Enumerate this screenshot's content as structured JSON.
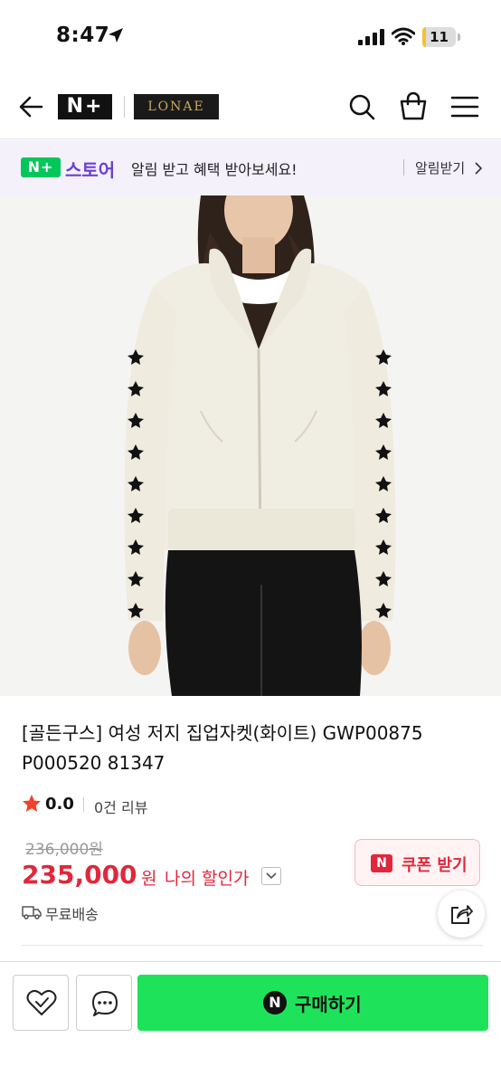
{
  "status_bar": {
    "time": "8:47",
    "battery": "11",
    "battery_level": 0.11
  },
  "header": {
    "platform_logo": "N+",
    "brand_logo": "LONAE"
  },
  "promo": {
    "badge": "N+",
    "store": "스토어",
    "message": "알림 받고 혜택 받아보세요!",
    "action": "알림받기"
  },
  "product": {
    "title": "[골든구스] 여성 저지 집업자켓(화이트) GWP00875 P000520 81347",
    "rating": "0.0",
    "reviews": "0건 리뷰",
    "original_price": "236,000원",
    "sale_price": "235,000",
    "sale_unit": "원",
    "my_price_label": "나의 할인가",
    "shipping": "무료배송"
  },
  "coupon": {
    "icon": "N",
    "label": "쿠폰 받기"
  },
  "bottom_bar": {
    "npay_icon": "N",
    "buy_label": "구매하기"
  },
  "colors": {
    "accent_green": "#1ee35a",
    "price_red": "#e0283c",
    "store_purple": "#6b3fd6"
  }
}
